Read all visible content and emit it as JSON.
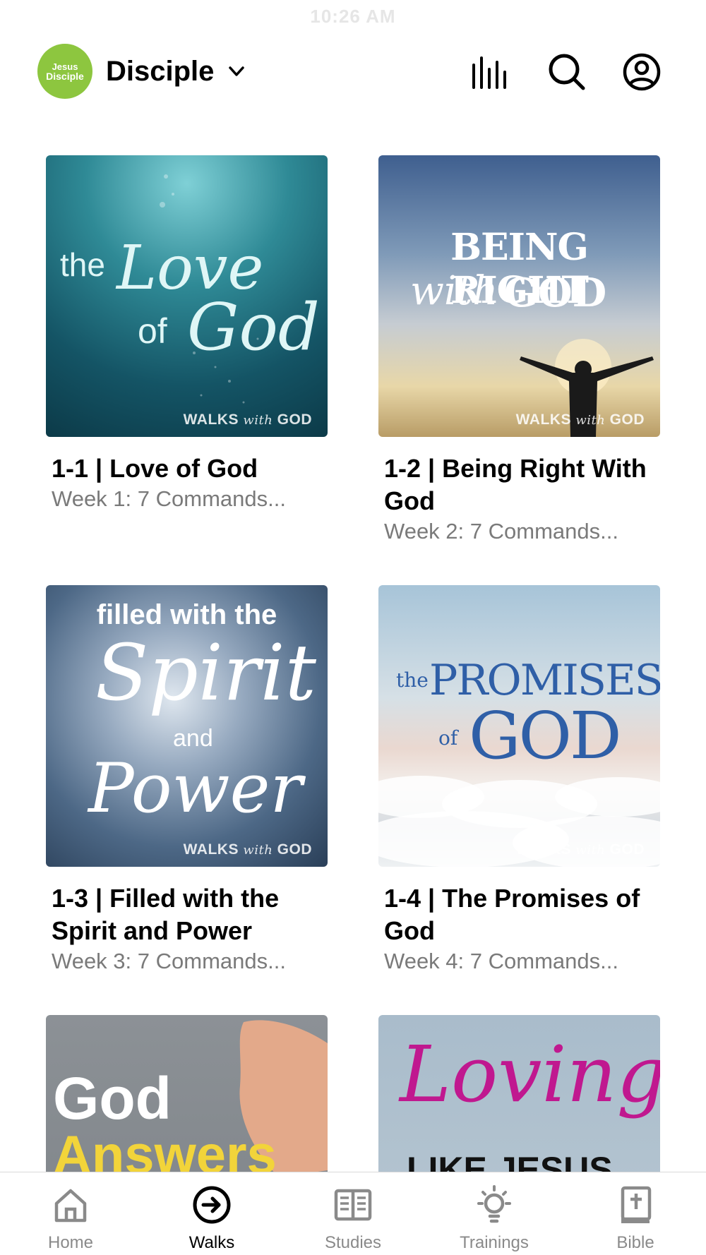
{
  "status": {
    "time": "10:26 AM"
  },
  "header": {
    "logo_line1": "Jesus",
    "logo_line2": "Disciple",
    "app_name": "Disciple",
    "icons": [
      "audio-bars-icon",
      "search-icon",
      "profile-icon"
    ]
  },
  "cards": [
    {
      "title": "1-1 | Love of God",
      "subtitle": "Week 1: 7 Commands...",
      "art": {
        "line1": "the",
        "line2": "Love",
        "line3": "of",
        "line4": "God",
        "brand_a": "WALKS",
        "brand_b": "with",
        "brand_c": "GOD"
      }
    },
    {
      "title": "1-2 | Being Right With God",
      "subtitle": "Week 2: 7 Commands...",
      "art": {
        "line1": "BEING RIGHT",
        "line2": "with",
        "line3": "GOD",
        "brand_a": "WALKS",
        "brand_b": "with",
        "brand_c": "GOD"
      }
    },
    {
      "title": "1-3 | Filled with the Spirit and Power",
      "subtitle": "Week 3: 7 Commands...",
      "art": {
        "line1": "filled with the",
        "line2": "Spirit",
        "line3": "and",
        "line4": "Power",
        "brand_a": "WALKS",
        "brand_b": "with",
        "brand_c": "GOD"
      }
    },
    {
      "title": "1-4 | The Promises of God",
      "subtitle": "Week 4: 7 Commands...",
      "art": {
        "line1": "the",
        "line2": "PROMISES",
        "line3": "of",
        "line4": "GOD",
        "brand_a": "WALKS",
        "brand_b": "with",
        "brand_c": "GOD"
      }
    },
    {
      "title": "",
      "subtitle": "",
      "art": {
        "line1": "God",
        "line2": "Answers"
      }
    },
    {
      "title": "",
      "subtitle": "",
      "art": {
        "line1": "Loving",
        "line2": "LIKE JESUS"
      }
    }
  ],
  "tabs": [
    {
      "label": "Home",
      "icon": "home-icon",
      "active": false
    },
    {
      "label": "Walks",
      "icon": "arrow-circle-icon",
      "active": true
    },
    {
      "label": "Studies",
      "icon": "open-book-icon",
      "active": false
    },
    {
      "label": "Trainings",
      "icon": "lightbulb-icon",
      "active": false
    },
    {
      "label": "Bible",
      "icon": "bible-icon",
      "active": false
    }
  ],
  "colors": {
    "accent_green": "#8dc63f",
    "muted_text": "#7a7a7a",
    "tab_inactive": "#8a8a8a",
    "promises_blue": "#2f5fa7",
    "answers_yellow": "#f2d43a",
    "loving_magenta": "#c0188f"
  }
}
